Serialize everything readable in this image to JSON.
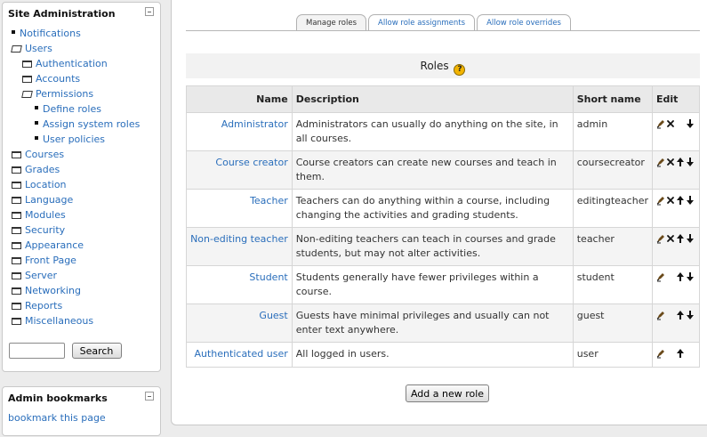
{
  "sidebar": {
    "title": "Site Administration",
    "items": [
      {
        "label": "Notifications",
        "level": 0,
        "kind": "bullet"
      },
      {
        "label": "Users",
        "level": 0,
        "kind": "folder-open"
      },
      {
        "label": "Authentication",
        "level": 1,
        "kind": "folder"
      },
      {
        "label": "Accounts",
        "level": 1,
        "kind": "folder"
      },
      {
        "label": "Permissions",
        "level": 1,
        "kind": "folder-open"
      },
      {
        "label": "Define roles",
        "level": 2,
        "kind": "bullet"
      },
      {
        "label": "Assign system roles",
        "level": 2,
        "kind": "bullet"
      },
      {
        "label": "User policies",
        "level": 2,
        "kind": "bullet"
      },
      {
        "label": "Courses",
        "level": 0,
        "kind": "folder"
      },
      {
        "label": "Grades",
        "level": 0,
        "kind": "folder"
      },
      {
        "label": "Location",
        "level": 0,
        "kind": "folder"
      },
      {
        "label": "Language",
        "level": 0,
        "kind": "folder"
      },
      {
        "label": "Modules",
        "level": 0,
        "kind": "folder"
      },
      {
        "label": "Security",
        "level": 0,
        "kind": "folder"
      },
      {
        "label": "Appearance",
        "level": 0,
        "kind": "folder"
      },
      {
        "label": "Front Page",
        "level": 0,
        "kind": "folder"
      },
      {
        "label": "Server",
        "level": 0,
        "kind": "folder"
      },
      {
        "label": "Networking",
        "level": 0,
        "kind": "folder"
      },
      {
        "label": "Reports",
        "level": 0,
        "kind": "folder"
      },
      {
        "label": "Miscellaneous",
        "level": 0,
        "kind": "folder"
      }
    ],
    "search": {
      "value": "",
      "button_label": "Search"
    }
  },
  "bookmarks": {
    "title": "Admin bookmarks",
    "link_label": "bookmark this page"
  },
  "tabs": [
    {
      "label": "Manage roles",
      "active": true
    },
    {
      "label": "Allow role assignments",
      "active": false
    },
    {
      "label": "Allow role overrides",
      "active": false
    }
  ],
  "roles_heading": "Roles",
  "table": {
    "headers": {
      "name": "Name",
      "description": "Description",
      "short_name": "Short name",
      "edit": "Edit"
    },
    "rows": [
      {
        "name": "Administrator",
        "description": "Administrators can usually do anything on the site, in all courses.",
        "short_name": "admin",
        "edit_icons": [
          "edit-icon",
          "delete-icon",
          null,
          "move-down-icon"
        ]
      },
      {
        "name": "Course creator",
        "description": "Course creators can create new courses and teach in them.",
        "short_name": "coursecreator",
        "edit_icons": [
          "edit-icon",
          "delete-icon",
          "move-up-icon",
          "move-down-icon"
        ]
      },
      {
        "name": "Teacher",
        "description": "Teachers can do anything within a course, including changing the activities and grading students.",
        "short_name": "editingteacher",
        "edit_icons": [
          "edit-icon",
          "delete-icon",
          "move-up-icon",
          "move-down-icon"
        ]
      },
      {
        "name": "Non-editing teacher",
        "description": "Non-editing teachers can teach in courses and grade students, but may not alter activities.",
        "short_name": "teacher",
        "edit_icons": [
          "edit-icon",
          "delete-icon",
          "move-up-icon",
          "move-down-icon"
        ]
      },
      {
        "name": "Student",
        "description": "Students generally have fewer privileges within a course.",
        "short_name": "student",
        "edit_icons": [
          "edit-icon",
          null,
          "move-up-icon",
          "move-down-icon"
        ]
      },
      {
        "name": "Guest",
        "description": "Guests have minimal privileges and usually can not enter text anywhere.",
        "short_name": "guest",
        "edit_icons": [
          "edit-icon",
          null,
          "move-up-icon",
          "move-down-icon"
        ]
      },
      {
        "name": "Authenticated user",
        "description": "All logged in users.",
        "short_name": "user",
        "edit_icons": [
          "edit-icon",
          null,
          "move-up-icon",
          null
        ]
      }
    ]
  },
  "add_role_button": "Add a new role",
  "colors": {
    "link": "#2a6ebb",
    "help_icon": "#f3b400"
  }
}
